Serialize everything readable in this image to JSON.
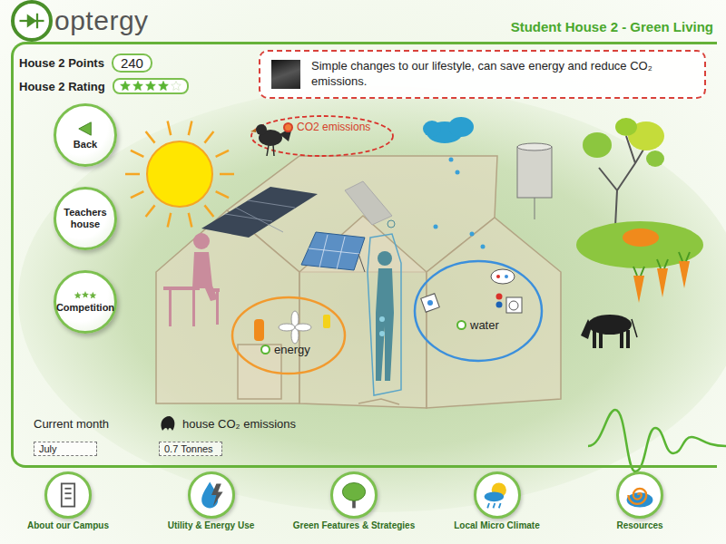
{
  "logo": {
    "text": "optergy"
  },
  "header": {
    "title": "Student House 2 - Green Living"
  },
  "stats": {
    "points_label": "House 2 Points",
    "points": "240",
    "rating_label": "House 2 Rating",
    "stars": 4,
    "max_stars": 5
  },
  "message": {
    "text": "Simple changes to our lifestyle, can save energy and reduce CO₂ emissions."
  },
  "nav_buttons": [
    {
      "label": "Back",
      "kind": "back"
    },
    {
      "label": "Teachers house",
      "kind": "house"
    },
    {
      "label": "Competition",
      "kind": "competition"
    }
  ],
  "scene_labels": [
    {
      "label": "CO2 emissions",
      "kind": "co2"
    },
    {
      "label": "energy",
      "kind": "energy"
    },
    {
      "label": "water",
      "kind": "water"
    }
  ],
  "footer_info": {
    "month_label": "Current month",
    "emissions_label": "house CO₂ emissions",
    "month": "July",
    "emissions": "0.7 Tonnes"
  },
  "bottom_nav": [
    {
      "label": "About our Campus",
      "kind": "campus"
    },
    {
      "label": "Utility & Energy Use",
      "kind": "utility"
    },
    {
      "label": "Green Features & Strategies",
      "kind": "green"
    },
    {
      "label": "Local Micro Climate",
      "kind": "climate"
    },
    {
      "label": "Resources",
      "kind": "resources"
    }
  ]
}
